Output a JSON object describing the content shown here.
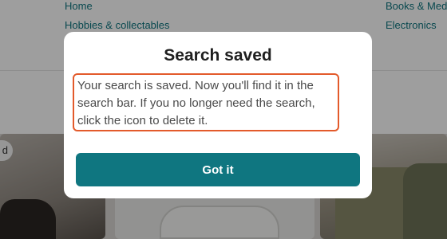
{
  "background": {
    "nav_links_left": [
      "Home",
      "Hobbies & collectables"
    ],
    "nav_links_right": [
      "Books & Med",
      "Electronics"
    ],
    "chip_label": "d"
  },
  "modal": {
    "title": "Search saved",
    "message": "Your search is saved. Now you'll find it in the search bar. If you no longer need the search, click the icon to delete it.",
    "button_label": "Got it"
  },
  "colors": {
    "accent": "#0f7680",
    "highlight_border": "#e35a2b",
    "overlay": "rgba(0,0,0,0.38)"
  }
}
